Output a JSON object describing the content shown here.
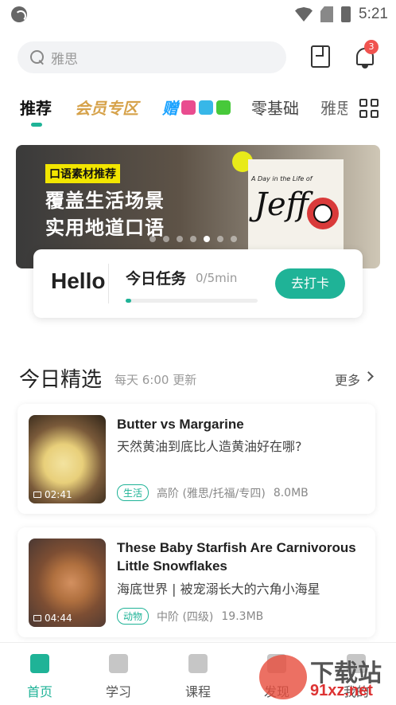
{
  "status_bar": {
    "time": "5:21"
  },
  "search": {
    "placeholder": "雅思"
  },
  "notifications": {
    "badge": "3"
  },
  "tabs": [
    {
      "label": "推荐",
      "active": true
    },
    {
      "label": "会员专区"
    },
    {
      "label": "赠"
    },
    {
      "label": "零基础"
    },
    {
      "label": "雅思"
    }
  ],
  "banner": {
    "chip": "口语素材推荐",
    "line1": "覆盖生活场景",
    "line2": "实用地道口语",
    "poster_title": "A Day in the Life of",
    "poster_name": "Jeff",
    "dots_count": 7,
    "active_dot": 4
  },
  "task": {
    "hello": "Hello",
    "title": "今日任务",
    "progress_text": "0/5min",
    "progress": 0.04,
    "button": "去打卡"
  },
  "section": {
    "title": "今日精选",
    "subtitle": "每天 6:00 更新",
    "more": "更多"
  },
  "cards": [
    {
      "title": "Butter vs Margarine",
      "subtitle": "天然黄油到底比人造黄油好在哪?",
      "duration": "02:41",
      "tag": "生活",
      "level": "高阶 (雅思/托福/专四)",
      "size": "8.0MB"
    },
    {
      "title": "These Baby Starfish Are Carnivorous Little Snowflakes",
      "subtitle": "海底世界 | 被宠溺长大的六角小海星",
      "duration": "04:44",
      "tag": "动物",
      "level": "中阶 (四级)",
      "size": "19.3MB"
    }
  ],
  "nav": [
    {
      "label": "首页",
      "icon": "home-icon",
      "active": true
    },
    {
      "label": "学习",
      "icon": "play-book-icon"
    },
    {
      "label": "课程",
      "icon": "chart-icon"
    },
    {
      "label": "发现",
      "icon": "discover-icon"
    },
    {
      "label": "我的",
      "icon": "profile-icon"
    }
  ],
  "watermark": {
    "big": "下载站",
    "small": "91xz.net"
  },
  "colors": {
    "accent": "#1fb397",
    "badge": "#f0534f",
    "vip": "#d6a24a"
  }
}
